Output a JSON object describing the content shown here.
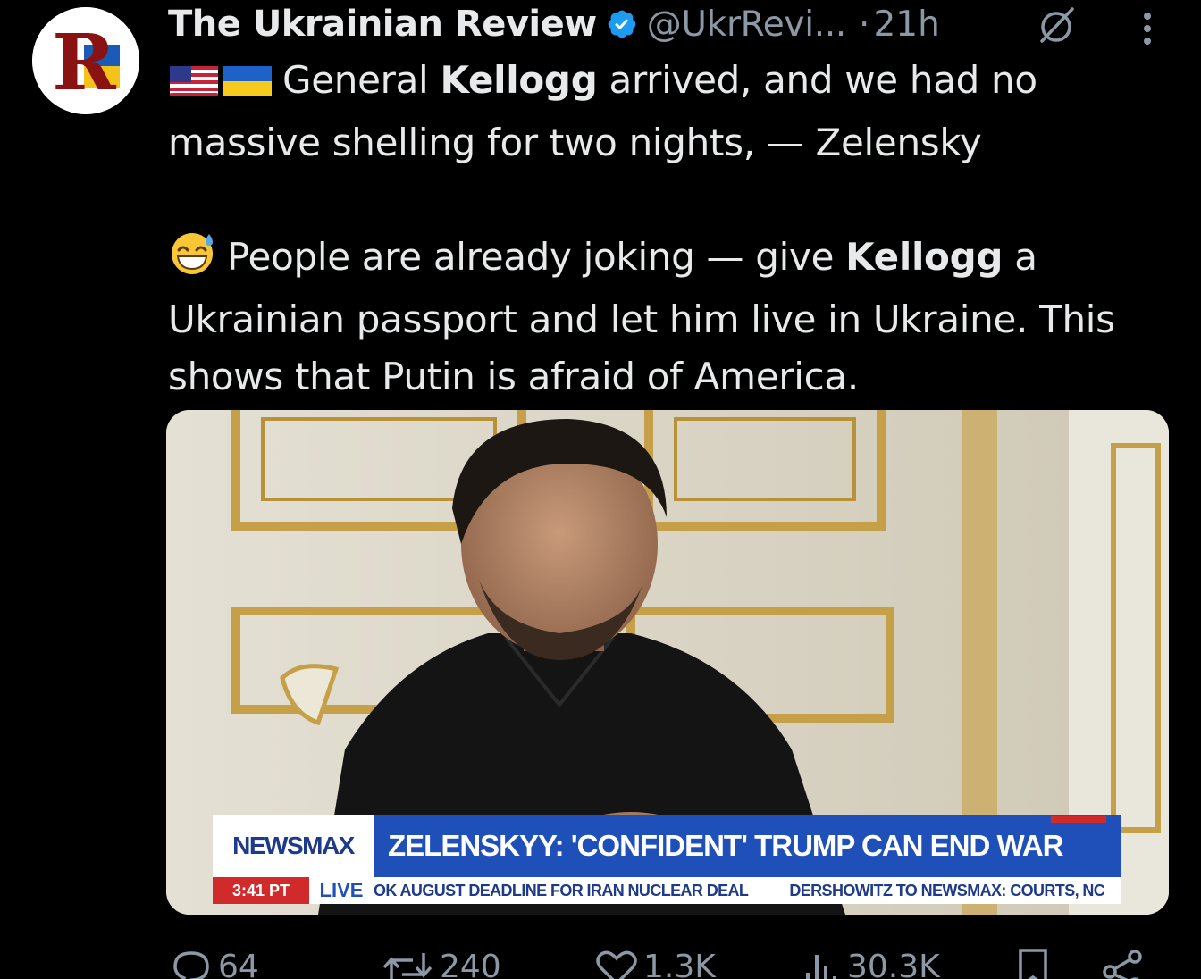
{
  "account": {
    "display_name": "The Ukrainian Review",
    "handle": "@UkrRevi...",
    "separator": "·",
    "time": "21h",
    "avatar_letter": "R"
  },
  "tweet": {
    "line1_emoji": "🇺🇸🇺🇦",
    "line1_pre": "General ",
    "line1_bold": "Kellogg",
    "line1_post": " arrived, and we had no massive shelling for two nights, — Zelensky",
    "line2_emoji": "😅",
    "line2_pre": "People are already joking — give ",
    "line2_bold": "Kellogg",
    "line2_post": " a Ukrainian passport and let him live in Ukraine. This shows that Putin is afraid of America."
  },
  "media": {
    "chyron_logo": "NEWSMAX",
    "chyron_headline": "ZELENSKYY: 'CONFIDENT' TRUMP CAN END WAR",
    "chyron_time": "3:41 PT",
    "chyron_live": "LIVE",
    "ticker_1": "OK AUGUST DEADLINE FOR IRAN NUCLEAR DEAL",
    "ticker_2": "DERSHOWITZ TO NEWSMAX: COURTS, NC"
  },
  "actions": {
    "replies": "64",
    "reposts": "240",
    "likes": "1.3K",
    "views": "30.3K"
  },
  "icons": {
    "verified": "verified-badge-icon",
    "grok": "grok-icon",
    "more": "more-options-icon",
    "reply": "reply-icon",
    "repost": "repost-icon",
    "like": "like-icon",
    "views": "views-icon",
    "bookmark": "bookmark-icon",
    "share": "share-icon"
  },
  "colors": {
    "background": "#000000",
    "text": "#e7e9ea",
    "muted": "#8b98a5",
    "verified": "#1d9bf0",
    "newsmax_blue": "#1f4fb8",
    "newsmax_red": "#d12a2a"
  }
}
